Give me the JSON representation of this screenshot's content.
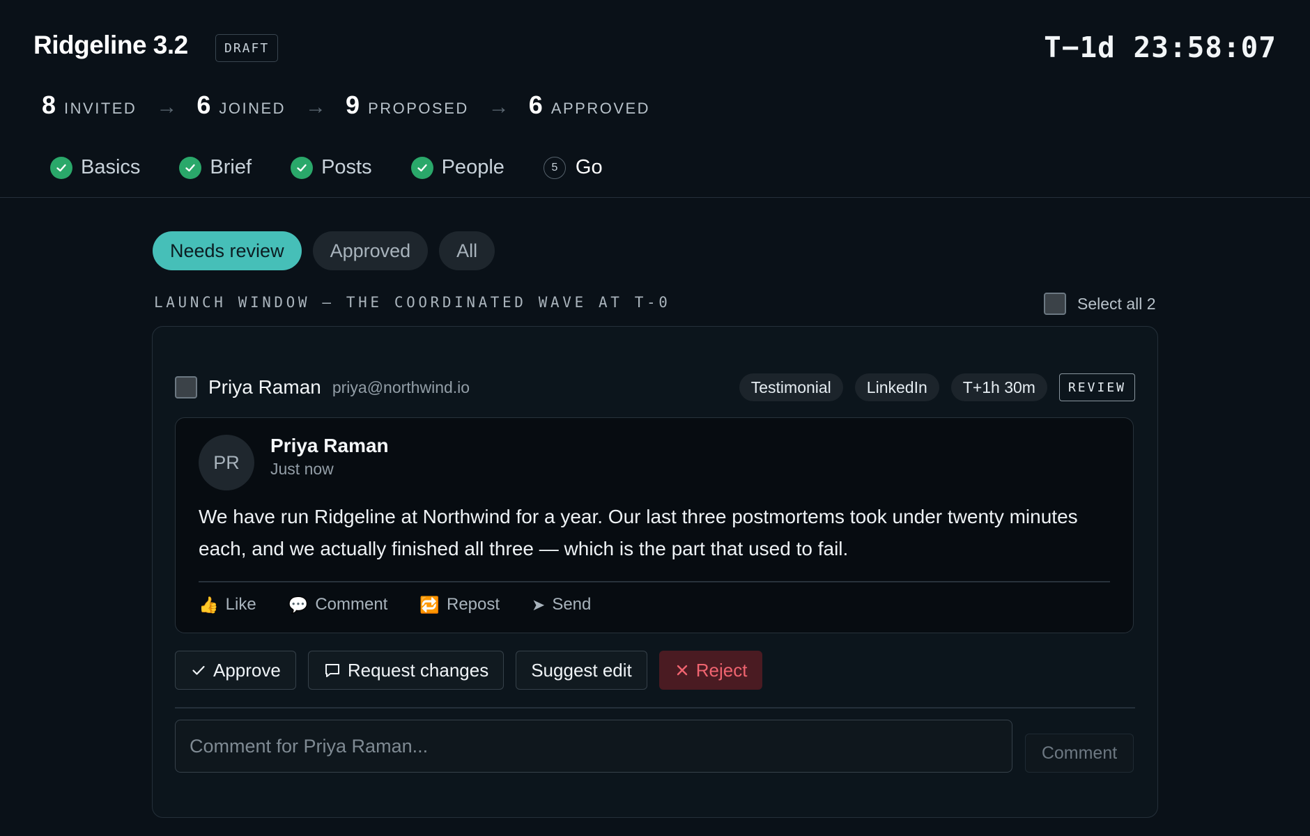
{
  "header": {
    "title": "Ridgeline 3.2",
    "status_badge": "DRAFT",
    "countdown": "T−1d 23:58:07"
  },
  "funnel": [
    {
      "count": "8",
      "label": "INVITED"
    },
    {
      "count": "6",
      "label": "JOINED"
    },
    {
      "count": "9",
      "label": "PROPOSED"
    },
    {
      "count": "6",
      "label": "APPROVED"
    }
  ],
  "funnel_arrow": "→",
  "steps": [
    {
      "label": "Basics",
      "state": "complete"
    },
    {
      "label": "Brief",
      "state": "complete"
    },
    {
      "label": "Posts",
      "state": "complete"
    },
    {
      "label": "People",
      "state": "complete"
    },
    {
      "label": "Go",
      "number": "5",
      "state": "current"
    }
  ],
  "filters": [
    {
      "label": "Needs review",
      "active": true
    },
    {
      "label": "Approved",
      "active": false
    },
    {
      "label": "All",
      "active": false
    }
  ],
  "section": {
    "title": "LAUNCH WINDOW — THE COORDINATED WAVE AT T-0",
    "select_all_label": "Select all 2"
  },
  "card": {
    "author_name": "Priya Raman",
    "author_email": "priya@northwind.io",
    "chips": [
      "Testimonial",
      "LinkedIn",
      "T+1h 30m"
    ],
    "status": "REVIEW",
    "post": {
      "avatar_initials": "PR",
      "author": "Priya Raman",
      "time": "Just now",
      "text": "We have run Ridgeline at Northwind for a year. Our last three postmortems took under twenty minutes each, and we actually finished all three — which is the part that used to fail.",
      "reactions": [
        {
          "icon": "👍",
          "icon_name": "thumbs-up-icon",
          "label": "Like"
        },
        {
          "icon": "💬",
          "icon_name": "speech-bubble-icon",
          "label": "Comment"
        },
        {
          "icon": "🔁",
          "icon_name": "repost-icon",
          "label": "Repost"
        },
        {
          "icon": "➤",
          "icon_name": "send-arrow-icon",
          "label": "Send"
        }
      ]
    },
    "actions": {
      "approve": "Approve",
      "request_changes": "Request changes",
      "suggest_edit": "Suggest edit",
      "reject": "Reject"
    },
    "comment": {
      "placeholder": "Comment for Priya Raman...",
      "value": "",
      "button": "Comment"
    }
  },
  "colors": {
    "background": "#0a1118",
    "accent_teal": "#46bfb8",
    "success_green": "#2aa86a",
    "danger_red": "#f06470",
    "danger_bg": "#4a1b22"
  }
}
